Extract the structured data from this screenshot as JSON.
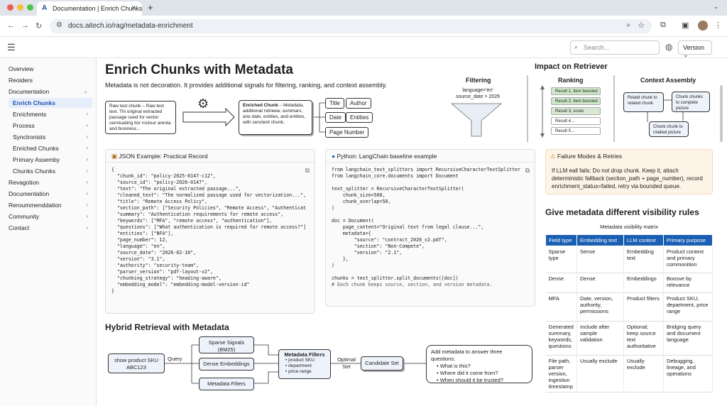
{
  "browser": {
    "tab_title": "Documentation | Enrich Chunks",
    "url": "docs.aitech.io/rag/metadata-enrichment"
  },
  "header": {
    "search_placeholder": "Search...",
    "version_label": "Version"
  },
  "sidebar": {
    "items": [
      {
        "label": "Overview"
      },
      {
        "label": "Reoiders"
      },
      {
        "label": "Documentation"
      },
      {
        "label": "Enrich Chunks"
      },
      {
        "label": "Enrichments"
      },
      {
        "label": "Process"
      },
      {
        "label": "Synctronists"
      },
      {
        "label": "Enriched Chunks"
      },
      {
        "label": "Primary Assemby"
      },
      {
        "label": "Chunks Chunks"
      },
      {
        "label": "Revagotion"
      },
      {
        "label": "Documentation"
      },
      {
        "label": "Reroummenddation"
      },
      {
        "label": "Community"
      },
      {
        "label": "Contact"
      }
    ]
  },
  "page": {
    "title": "Enrich Chunks with Metadata",
    "lead": "Metadata is not decoration. It provides additional signals for filtering, ranking, and context assembly."
  },
  "diagram1": {
    "raw_chunk": "Raw text chunk – Raw text text. Thi original extracted passage used for vector cenniuating tior roctour arenta and business…",
    "enriched_chunk_bold": "Enriched Chunk",
    "enriched_chunk": " – Metadata, additional rstrieew, summars, ane date, entities, and entities, with cenctent chunk.",
    "tags": [
      "Title",
      "Author",
      "Date",
      "Entities",
      "Page Number"
    ]
  },
  "impact": {
    "title": "Impact on Retriever",
    "filtering": {
      "title": "Filtering",
      "cond1": "language='en'",
      "cond2": "source_date > 2026"
    },
    "ranking": {
      "title": "Ranking",
      "results": [
        "Result 1, item boosted",
        "Result 2, item boosted",
        "Result 3, score",
        "Result 4…",
        "Result 5…"
      ]
    },
    "context": {
      "title": "Context Assembly",
      "b1": "Relatd chunk to related chunk",
      "b2": "Chunk chunks to complete picture",
      "b3": "Chunk chunk to rolalied picture"
    }
  },
  "json_card": {
    "title": "JSON Example: Practical Record",
    "lines": [
      "{",
      "  \"chunk_id\": \"policy-2025-0147-c12\",",
      "  \"source_id\": \"policy-2026-0147\",",
      "  \"text\": \"The original extracted passage...\",",
      "  \"cleaned_text\": \"The normalized passage used for vectorization...\",",
      "  \"title\": \"Remote Access Policy\",",
      "  \"section_path\": [\"Security Policies\", \"Remote Access\", \"Authenticat",
      "  \"summary\": \"Authentication requirements for remote access\",",
      "  \"keywords\": [\"MFA\", \"remote access\", \"authentication\"],",
      "  \"questions\": [\"What authentication is required for remote access?\"]",
      "  \"entities\": [\"NFA\"],",
      "  \"page_number\": 12,",
      "  \"language\": \"en\",",
      "  \"source_date\": \"2026-02-10\",",
      "  \"version\": \"3.1\",",
      "  \"authority\": \"security-team\",",
      "  \"parser_version\": \"pdf-layout-v2\",",
      "  \"chunking_strategy\": \"heading-aware\",",
      "  \"embedding_model\": \"embedding-model-version-id\"",
      "}"
    ]
  },
  "py_card": {
    "title": "Python: LangChain baseline example",
    "lines": [
      "from langchain_text_splitters import RecursiveCharacterTextSplitter",
      "from langchain_core.documents import Document",
      "",
      "text_splitter = RecursiveCharacterTextSplitter(",
      "    chunk_size=500,",
      "    chunk_overlap=50,",
      ")",
      "",
      "doc = Document(",
      "    page_content=\"Original text from legal clause...\",",
      "    metadata={",
      "        \"source\": \"contract_2026_v2.pdf\",",
      "        \"section\": \"Non-Compete\",",
      "        \"version\": \"2.1\",",
      "    },",
      ")",
      "",
      "chunks = text_splitter.split_documents([doc])",
      "# Each chunk keeps source, section, and version metadata."
    ]
  },
  "failure": {
    "title": "Failure Modes & Retries",
    "body": "If LLM eall fails: Do not drop chunk. Keep it, attach deterministic fallback (section_path + page_number), record enrichment_status=failed, retry via bounded queue."
  },
  "visibility": {
    "heading": "Give metadata different visibility rules",
    "caption": "Metadata visibility matrix",
    "columns": [
      "Field type",
      "Embedding text",
      "LLM context",
      "Primary purpose"
    ],
    "rows": [
      [
        "Sparse type",
        "Sense",
        "Embedding text",
        "Product context and primary commonition"
      ],
      [
        "Dense",
        "Dense",
        "Embeddings",
        "Boosve by relevance"
      ],
      [
        "MFA",
        "Date, version, authority, permissions",
        "Product filters",
        "Product SKU, department, price range"
      ],
      [
        "Generated summary, keywords, questions",
        "Include after sample validation",
        "Optional; keep source text authoritative",
        "Bridging query and document language"
      ],
      [
        "File path, parser version, ingestion timestamp",
        "Usually exclude",
        "Usually exclude",
        "Debugging, lineage, and operations"
      ]
    ]
  },
  "hybrid": {
    "heading": "Hybrid Retrieval with Metadata",
    "query_box": "show product SKU ABC123",
    "query_label": "Query",
    "sparse": "Sparse Signals (BM25)",
    "dense": "Dense Embeddings",
    "filters": "Metadata Filters",
    "mf_title": "Metadata Filters",
    "mf_items": [
      "product SKU",
      "department",
      "price range"
    ],
    "optimal": "Optimal Set",
    "candidate": "Candidate Set",
    "q_title": "Add metadata to answer three questions:",
    "questions": [
      "What is this?",
      "Where did it come from?",
      "When should it be trusted?"
    ]
  }
}
